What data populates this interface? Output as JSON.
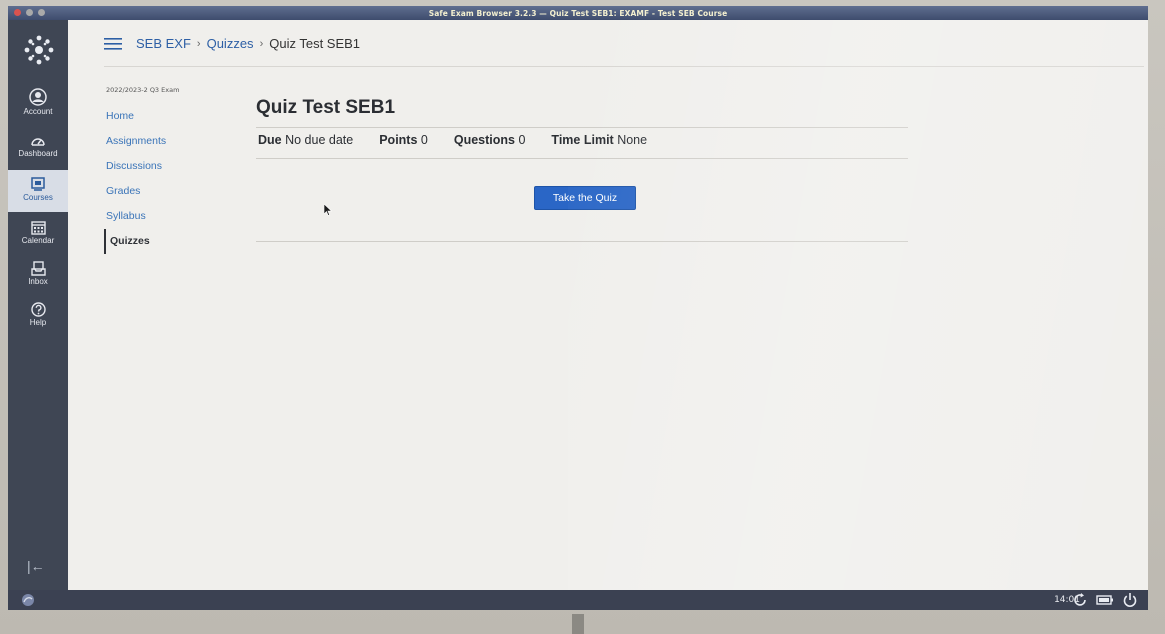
{
  "window": {
    "title": "Safe Exam Browser 3.2.3 — Quiz Test SEB1: EXAMF - Test SEB Course"
  },
  "global_nav": {
    "items": [
      {
        "label": "Account",
        "icon": "account-icon"
      },
      {
        "label": "Dashboard",
        "icon": "dashboard-icon"
      },
      {
        "label": "Courses",
        "icon": "courses-icon",
        "active": true
      },
      {
        "label": "Calendar",
        "icon": "calendar-icon"
      },
      {
        "label": "Inbox",
        "icon": "inbox-icon"
      },
      {
        "label": "Help",
        "icon": "help-icon"
      }
    ],
    "collapse_glyph": "|←"
  },
  "breadcrumb": {
    "course": "SEB EXF",
    "section": "Quizzes",
    "current": "Quiz Test SEB1",
    "separator": "›"
  },
  "course_nav": {
    "term": "2022/2023-2 Q3 Exam",
    "links": [
      "Home",
      "Assignments",
      "Discussions",
      "Grades",
      "Syllabus",
      "Quizzes"
    ],
    "active": "Quizzes"
  },
  "quiz": {
    "title": "Quiz Test SEB1",
    "due_label": "Due",
    "due_value": "No due date",
    "points_label": "Points",
    "points_value": "0",
    "questions_label": "Questions",
    "questions_value": "0",
    "time_limit_label": "Time Limit",
    "time_limit_value": "None",
    "take_button": "Take the Quiz"
  },
  "taskbar": {
    "clock": "14:01"
  },
  "colors": {
    "accent": "#2a66c6",
    "link": "#3a74b8",
    "nav_bg": "#3f4654"
  }
}
